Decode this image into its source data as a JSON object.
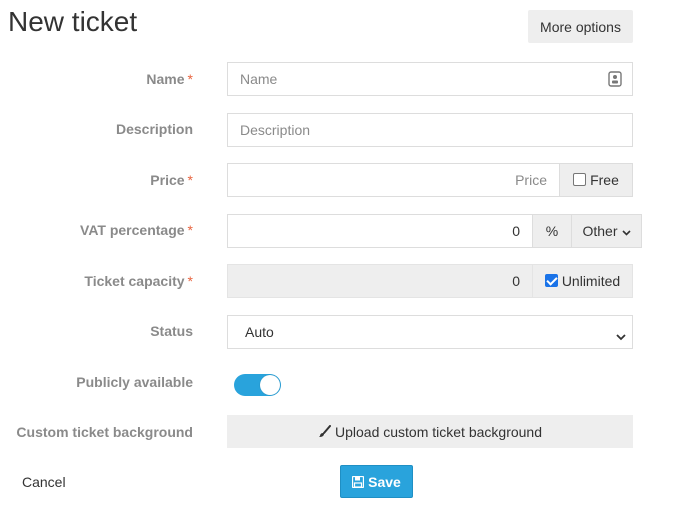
{
  "page": {
    "title": "New ticket",
    "more_options": "More options"
  },
  "fields": {
    "name": {
      "label": "Name",
      "required": "*",
      "placeholder": "Name"
    },
    "description": {
      "label": "Description",
      "placeholder": "Description"
    },
    "price": {
      "label": "Price",
      "required": "*",
      "placeholder": "Price",
      "free_label": "Free",
      "free_checked": false
    },
    "vat": {
      "label": "VAT percentage",
      "required": "*",
      "value": "0",
      "unit": "%",
      "other_label": "Other"
    },
    "capacity": {
      "label": "Ticket capacity",
      "required": "*",
      "value": "0",
      "unlimited_label": "Unlimited",
      "unlimited_checked": true
    },
    "status": {
      "label": "Status",
      "value": "Auto"
    },
    "public": {
      "label": "Publicly available",
      "enabled": true
    },
    "background": {
      "label": "Custom ticket background",
      "button": "Upload custom ticket background"
    }
  },
  "actions": {
    "cancel": "Cancel",
    "save": "Save"
  },
  "colors": {
    "accent": "#29a3dc",
    "required": "#e8623d",
    "label": "#8a8a8a"
  },
  "icons": {
    "name_field": "contact-card-icon",
    "upload": "paintbrush-icon",
    "save": "floppy-disk-icon",
    "dropdown": "chevron-down-icon"
  }
}
